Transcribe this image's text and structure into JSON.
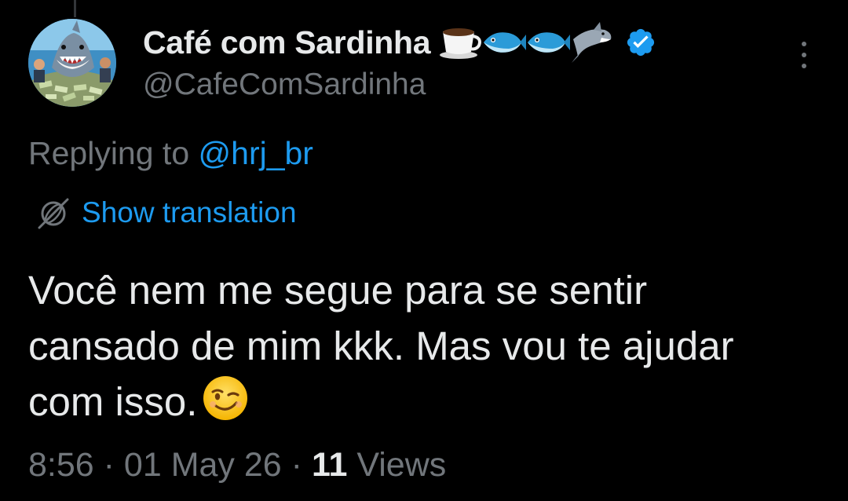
{
  "author": {
    "display_name": "Café com Sardinha",
    "name_emojis": [
      "coffee-cup-emoji",
      "fish-emoji",
      "fish-emoji",
      "shark-emoji"
    ],
    "verified": true,
    "handle": "@CafeComSardinha",
    "avatar": "shark-with-money-avatar"
  },
  "reply": {
    "prefix": "Replying to ",
    "mention": "@hrj_br"
  },
  "translation": {
    "label": "Show translation",
    "icon": "globe-icon"
  },
  "tweet": {
    "lines": [
      "Você nem me segue para se sentir",
      "cansado de mim kkk. Mas vou te ajudar",
      "com isso."
    ],
    "trailing_emoji": "winking-face-emoji"
  },
  "meta": {
    "time": "8:56",
    "date": "01 May 26",
    "separator": " · ",
    "views_count": "11",
    "views_label": " Views"
  },
  "colors": {
    "background": "#000000",
    "text_primary": "#e7e9ea",
    "text_secondary": "#71767b",
    "accent": "#1d9bf0"
  }
}
